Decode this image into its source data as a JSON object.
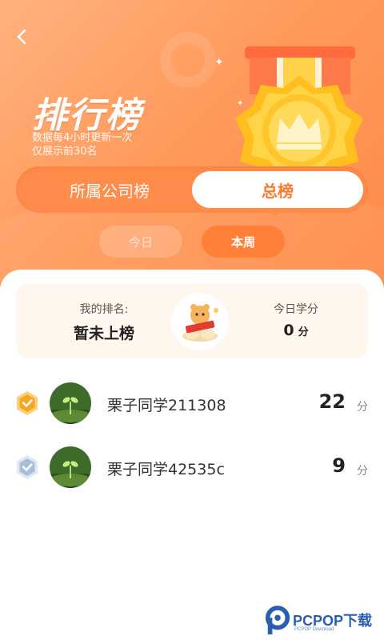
{
  "header": {
    "title": "排行榜",
    "subtitle_line1": "数据每4小时更新一次",
    "subtitle_line2": "仅展示前30名"
  },
  "tabs": {
    "company": "所属公司榜",
    "overall": "总榜",
    "active": "overall"
  },
  "periods": {
    "today": "今日",
    "week": "本周",
    "active": "week"
  },
  "my_rank": {
    "rank_label": "我的排名:",
    "rank_value": "暂未上榜",
    "today_label": "今日学分",
    "today_value": "0",
    "today_unit": "分"
  },
  "leaderboard": [
    {
      "name": "栗子同学211308",
      "score": "22",
      "unit": "分",
      "badge": "gold"
    },
    {
      "name": "栗子同学42535c",
      "score": "9",
      "unit": "分",
      "badge": "silver"
    }
  ],
  "watermark": {
    "brand": "PCPOP下载",
    "sub": "PCPOP Download"
  },
  "colors": {
    "accent": "#ff7a2e",
    "header_gradient_start": "#ffb27e",
    "header_gradient_end": "#ff8a48",
    "card_bg": "#fff6ee"
  },
  "icons": {
    "back": "chevron-left-icon",
    "medal": "crown-medal-icon",
    "gold_badge": "gold-rank-badge-icon",
    "silver_badge": "silver-rank-badge-icon"
  }
}
